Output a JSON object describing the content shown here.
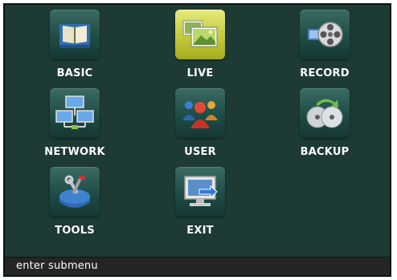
{
  "menu": {
    "items": [
      {
        "label": "BASIC",
        "icon": "book-icon"
      },
      {
        "label": "LIVE",
        "icon": "live-preview-icon",
        "selected": true
      },
      {
        "label": "RECORD",
        "icon": "film-reel-icon"
      },
      {
        "label": "NETWORK",
        "icon": "network-computers-icon"
      },
      {
        "label": "USER",
        "icon": "users-icon"
      },
      {
        "label": "BACKUP",
        "icon": "disc-backup-icon"
      },
      {
        "label": "TOOLS",
        "icon": "tools-icon"
      },
      {
        "label": "EXIT",
        "icon": "exit-monitor-icon"
      }
    ]
  },
  "status": {
    "text": "enter  submenu"
  },
  "colors": {
    "background": "#1e3a35",
    "selected": "#c7cd3d",
    "statusbar": "#252525"
  }
}
